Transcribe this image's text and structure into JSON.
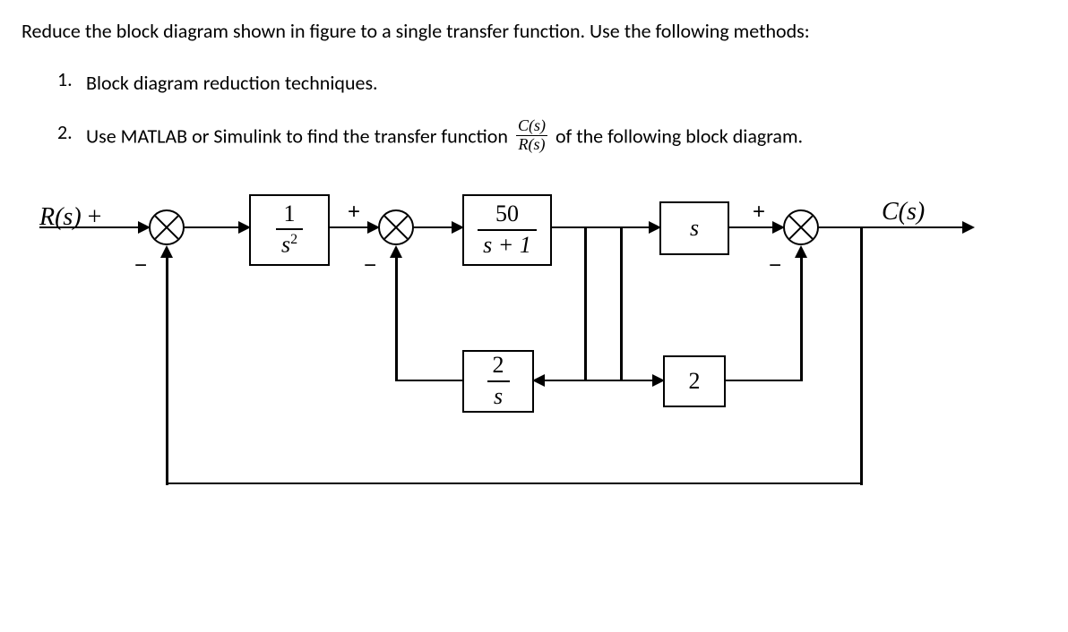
{
  "prompt": {
    "intro": "Reduce the block diagram shown in figure to a single transfer function. Use the following methods:",
    "item1": "Block diagram reduction techniques.",
    "item2_a": "Use MATLAB or Simulink to find the transfer function",
    "item2_b": "of the following block diagram.",
    "frac_num": "C(s)",
    "frac_den": "R(s)",
    "num1": "1.",
    "num2": "2."
  },
  "diagram": {
    "input_label": "R(s)",
    "output_label": "C(s)",
    "sum1": {
      "plus": "+",
      "minus": "−"
    },
    "sum2": {
      "plus": "+",
      "minus": "−"
    },
    "sum3": {
      "plus": "+",
      "minus": "−"
    },
    "block1": {
      "num": "1",
      "den": "s",
      "den_exp": "2"
    },
    "block2": {
      "num": "50",
      "den": "s + 1"
    },
    "block3": {
      "value": "s"
    },
    "block4": {
      "value": "2"
    },
    "block5": {
      "num": "2",
      "den": "s"
    }
  }
}
